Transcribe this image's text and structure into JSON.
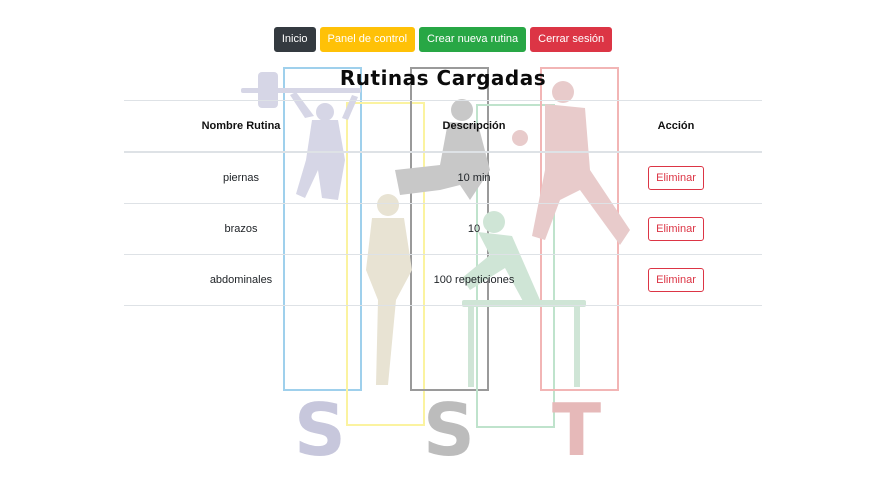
{
  "nav": {
    "buttons": [
      {
        "label": "Inicio",
        "color": "#343a40"
      },
      {
        "label": "Panel de control",
        "color": "#ffc107"
      },
      {
        "label": "Crear nueva rutina",
        "color": "#28a745"
      },
      {
        "label": "Cerrar sesión",
        "color": "#dc3545"
      }
    ]
  },
  "page": {
    "title": "Rutinas Cargadas"
  },
  "table": {
    "headers": [
      "Nombre Rutina",
      "Descripción",
      "Acción"
    ],
    "rows": [
      {
        "name": "piernas",
        "description": "10 min",
        "action": "Eliminar"
      },
      {
        "name": "brazos",
        "description": "10",
        "action": "Eliminar"
      },
      {
        "name": "abdominales",
        "description": "100 repeticiones",
        "action": "Eliminar"
      }
    ]
  },
  "colors": {
    "danger": "#dc3545",
    "dark": "#343a40",
    "warning": "#ffc107",
    "success": "#28a745"
  }
}
